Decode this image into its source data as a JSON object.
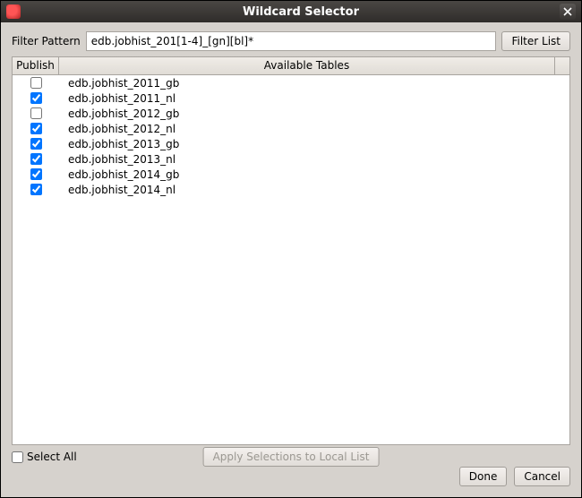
{
  "window": {
    "title": "Wildcard Selector"
  },
  "filter": {
    "label": "Filter Pattern",
    "value": "edb.jobhist_201[1-4]_[gn][bl]*",
    "button": "Filter List"
  },
  "columns": {
    "publish": "Publish",
    "available": "Available Tables"
  },
  "rows": [
    {
      "checked": false,
      "name": "edb.jobhist_2011_gb"
    },
    {
      "checked": true,
      "name": "edb.jobhist_2011_nl"
    },
    {
      "checked": false,
      "name": "edb.jobhist_2012_gb"
    },
    {
      "checked": true,
      "name": "edb.jobhist_2012_nl"
    },
    {
      "checked": true,
      "name": "edb.jobhist_2013_gb"
    },
    {
      "checked": true,
      "name": "edb.jobhist_2013_nl"
    },
    {
      "checked": true,
      "name": "edb.jobhist_2014_gb"
    },
    {
      "checked": true,
      "name": "edb.jobhist_2014_nl"
    }
  ],
  "footer": {
    "select_all": "Select All",
    "apply": "Apply Selections to Local List",
    "done": "Done",
    "cancel": "Cancel"
  }
}
